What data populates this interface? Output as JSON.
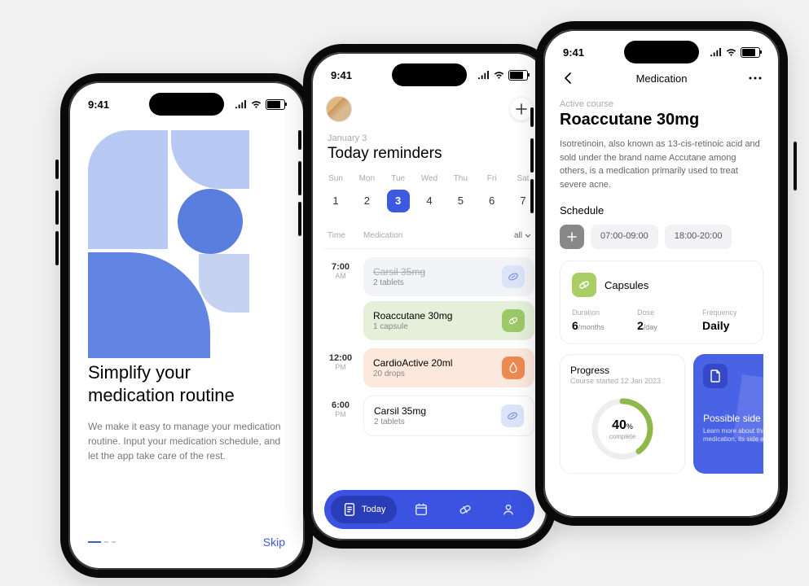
{
  "status_time": "9:41",
  "screen1": {
    "title_line1": "Simplify your",
    "title_line2": "medication routine",
    "description": "We make it easy to manage your medication routine. Input your medication schedule, and let the app take care of the rest.",
    "skip_label": "Skip"
  },
  "screen2": {
    "date_label": "January 3",
    "title": "Today reminders",
    "days": [
      {
        "name": "Sun",
        "num": "1",
        "selected": false
      },
      {
        "name": "Mon",
        "num": "2",
        "selected": false
      },
      {
        "name": "Tue",
        "num": "3",
        "selected": true
      },
      {
        "name": "Wed",
        "num": "4",
        "selected": false
      },
      {
        "name": "Thu",
        "num": "5",
        "selected": false
      },
      {
        "name": "Fri",
        "num": "6",
        "selected": false
      },
      {
        "name": "Sat",
        "num": "7",
        "selected": false
      }
    ],
    "col_time": "Time",
    "col_med": "Medication",
    "filter_label": "all",
    "slot1_time": "7:00",
    "slot1_ampm": "AM",
    "slot1_card1_name": "Carsil 35mg",
    "slot1_card1_dose": "2 tablets",
    "slot1_card2_name": "Roaccutane 30mg",
    "slot1_card2_dose": "1 capsule",
    "slot2_time": "12:00",
    "slot2_ampm": "PM",
    "slot2_card1_name": "CardioActive 20ml",
    "slot2_card1_dose": "20 drops",
    "slot3_time": "6:00",
    "slot3_ampm": "PM",
    "slot3_card1_name": "Carsil 35mg",
    "slot3_card1_dose": "2 tablets",
    "nav_today": "Today"
  },
  "screen3": {
    "nav_title": "Medication",
    "active_label": "Active course",
    "med_name": "Roaccutane 30mg",
    "description": "Isotretinoin, also known as 13-cis-retinoic acid and sold under the brand name Accutane among others, is a medication primarily used to treat severe acne.",
    "schedule_label": "Schedule",
    "time1": "07:00-09:00",
    "time2": "18:00-20:00",
    "type_label": "Capsules",
    "stat1_label": "Duration",
    "stat1_value": "6",
    "stat1_unit": "/months",
    "stat2_label": "Dose",
    "stat2_value": "2",
    "stat2_unit": "/day",
    "stat3_label": "Frequency",
    "stat3_value": "Daily",
    "progress_title": "Progress",
    "progress_sub": "Course started 12 Jan 2023",
    "progress_pct": "40",
    "progress_word": "complete",
    "side_title": "Possible side eff",
    "side_sub": "Learn more about this medication, its side effects"
  }
}
